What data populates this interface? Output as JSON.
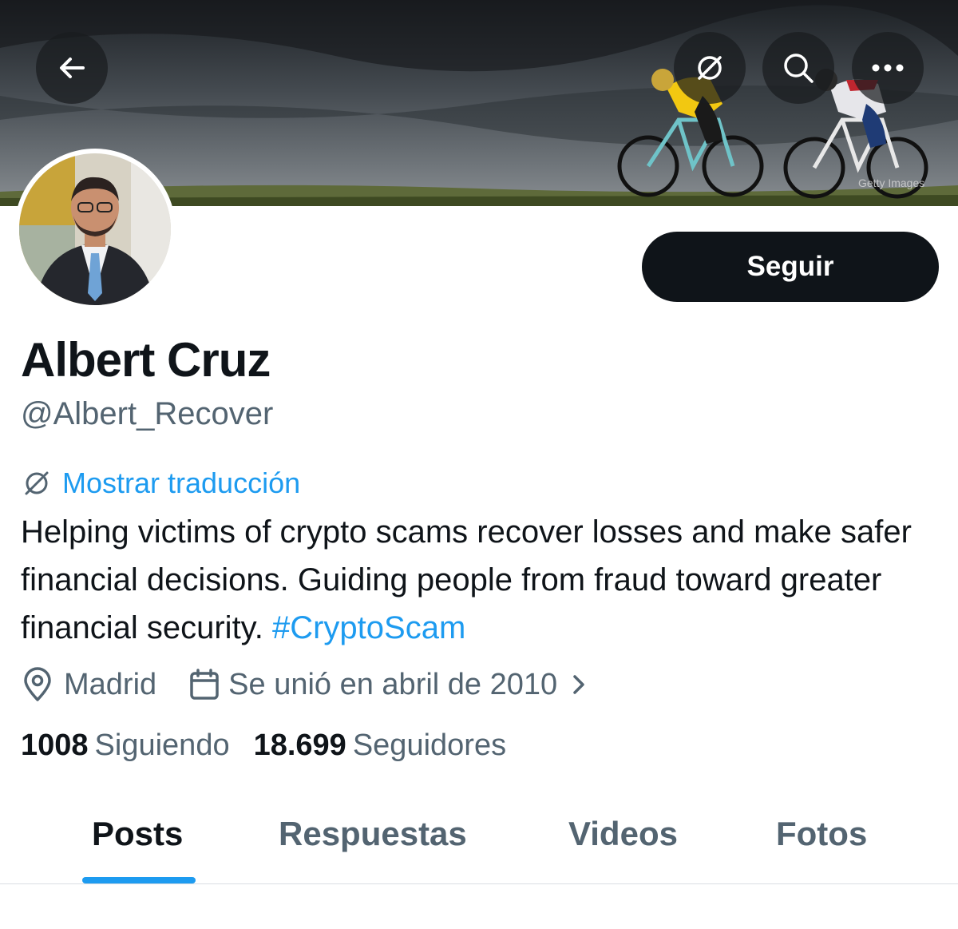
{
  "banner": {
    "watermark": "Getty Images"
  },
  "profile": {
    "name": "Albert Cruz",
    "handle": "@Albert_Recover",
    "follow_label": "Seguir",
    "translate_label": "Mostrar traducción",
    "bio_text": "Helping victims of crypto scams recover losses and make safer financial decisions. Guiding people from fraud toward greater financial security. ",
    "bio_hashtag": "#CryptoScam",
    "location": "Madrid",
    "joined": "Se unió en abril de 2010",
    "following_count": "1008",
    "following_label": "Siguiendo",
    "followers_count": "18.699",
    "followers_label": "Seguidores"
  },
  "tabs": [
    {
      "label": "Posts",
      "active": true
    },
    {
      "label": "Respuestas",
      "active": false
    },
    {
      "label": "Videos",
      "active": false
    },
    {
      "label": "Fotos",
      "active": false
    }
  ],
  "colors": {
    "accent": "#1d9bf0",
    "text": "#0f1419",
    "muted": "#536471"
  }
}
